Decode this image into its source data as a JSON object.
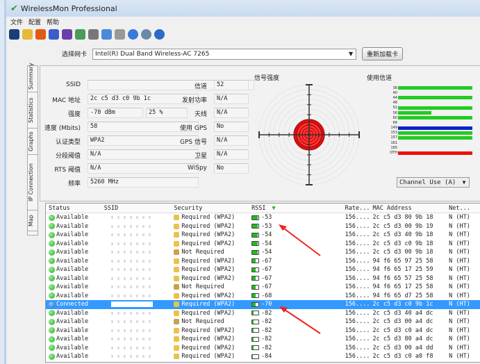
{
  "window": {
    "title": "WirelessMon Professional"
  },
  "menu": [
    "文件",
    "配置",
    "帮助"
  ],
  "toolbar": [
    "save-icon",
    "open-icon",
    "record-icon",
    "adapter-icon",
    "adapter-alt-icon",
    "network-icon",
    "print-icon",
    "settings-icon",
    "clipboard-icon",
    "web-icon",
    "update-icon",
    "help-icon"
  ],
  "nic": {
    "label": "选择网卡",
    "value": "Intel(R) Dual Band Wireless-AC 7265",
    "reload": "重新加载卡"
  },
  "tabs": [
    "Summary",
    "Statistics",
    "Graphs",
    "IP Connection",
    "Map"
  ],
  "summary": {
    "ssid_label": "SSID",
    "ssid": "",
    "mac_label": "MAC 地址",
    "mac": "2c c5 d3 c0 9b 1c",
    "strength_label": "强度",
    "strength_dbm": "-70 dBm",
    "strength_pct": "25 %",
    "speed_label": "速度 (Mbits)",
    "speed": "58",
    "auth_label": "认证类型",
    "auth": "WPA2",
    "frag_label": "分段阈值",
    "frag": "N/A",
    "rts_label": "RTS 阈值",
    "rts": "N/A",
    "freq_label": "频率",
    "freq": "5260 MHz",
    "channel_label": "信道",
    "channel": "52",
    "txpower_label": "发射功率",
    "txpower": "N/A",
    "antenna_label": "天线",
    "antenna": "N/A",
    "gps_label": "使用 GPS",
    "gps": "No",
    "gpssig_label": "GPS 信号",
    "gpssig": "N/A",
    "sat_label": "卫星",
    "sat": "N/A",
    "wispy_label": "WiSpy",
    "wispy": "No"
  },
  "signal": {
    "title": "信号强度",
    "percent": 25
  },
  "channels": {
    "title": "使用信道",
    "dropdown": "Channel Use (A)",
    "items": [
      {
        "ch": "36",
        "use": 1,
        "color": "#22cc22"
      },
      {
        "ch": "40",
        "use": 0,
        "color": "#22cc22"
      },
      {
        "ch": "44",
        "use": 1,
        "color": "#22cc22"
      },
      {
        "ch": "48",
        "use": 0,
        "color": "#22cc22"
      },
      {
        "ch": "52",
        "use": 1,
        "color": "#22cc22"
      },
      {
        "ch": "56",
        "use": 0.45,
        "color": "#22cc22"
      },
      {
        "ch": "60",
        "use": 1,
        "color": "#22cc22"
      },
      {
        "ch": "64",
        "use": 0,
        "color": "#22cc22"
      },
      {
        "ch": "149",
        "use": 1,
        "color": "#1122cc"
      },
      {
        "ch": "153",
        "use": 1,
        "color": "#22cc22"
      },
      {
        "ch": "157",
        "use": 1,
        "color": "#22cc22"
      },
      {
        "ch": "161",
        "use": 0,
        "color": "#22cc22"
      },
      {
        "ch": "165",
        "use": 0,
        "color": "#22cc22"
      },
      {
        "ch": "OTH",
        "use": 1,
        "color": "#ee1111"
      }
    ]
  },
  "list": {
    "headers": [
      "Status",
      "SSID",
      "Security",
      "RSSI",
      "Rate...",
      "MAC Address",
      "Net..."
    ],
    "rows": [
      {
        "status": "Available",
        "security": "Required (WPA2)",
        "rssi": "-53",
        "rate": "156....",
        "mac": "2c c5 d3 80 9b 18",
        "net": "N (HT)"
      },
      {
        "status": "Available",
        "security": "Required (WPA2)",
        "rssi": "-53",
        "rate": "156....",
        "mac": "2c c5 d3 00 9b 19",
        "net": "N (HT)"
      },
      {
        "status": "Available",
        "security": "Required (WPA2)",
        "rssi": "-54",
        "rate": "156....",
        "mac": "2c c5 d3 40 9b 18",
        "net": "N (HT)"
      },
      {
        "status": "Available",
        "security": "Required (WPA2)",
        "rssi": "-54",
        "rate": "156....",
        "mac": "2c c5 d3 c0 9b 18",
        "net": "N (HT)"
      },
      {
        "status": "Available",
        "security": "Not Required",
        "rssi": "-54",
        "rate": "156....",
        "mac": "2c c5 d3 00 9b 18",
        "net": "N (HT)"
      },
      {
        "status": "Available",
        "security": "Required (WPA2)",
        "rssi": "-67",
        "rate": "156....",
        "mac": "94 f6 65 97 25 58",
        "net": "N (HT)"
      },
      {
        "status": "Available",
        "security": "Required (WPA2)",
        "rssi": "-67",
        "rate": "156....",
        "mac": "94 f6 65 17 25 59",
        "net": "N (HT)"
      },
      {
        "status": "Available",
        "security": "Required (WPA2)",
        "rssi": "-67",
        "rate": "156....",
        "mac": "94 f6 65 57 25 58",
        "net": "N (HT)"
      },
      {
        "status": "Available",
        "security": "Not Required",
        "rssi": "-67",
        "rate": "156....",
        "mac": "94 f6 65 17 25 58",
        "net": "N (HT)"
      },
      {
        "status": "Available",
        "security": "Required (WPA2)",
        "rssi": "-68",
        "rate": "156....",
        "mac": "94 f6 65 d7 25 58",
        "net": "N (HT)"
      },
      {
        "status": "Connected",
        "security": "Required (WPA2)",
        "rssi": "-70",
        "rate": "156....",
        "mac": "2c c5 d3 c0 9b 1c",
        "net": "N (HT)",
        "selected": true
      },
      {
        "status": "Available",
        "security": "Required (WPA2)",
        "rssi": "-82",
        "rate": "156....",
        "mac": "2c c5 d3 40 a4 dc",
        "net": "N (HT)"
      },
      {
        "status": "Available",
        "security": "Not Required",
        "rssi": "-82",
        "rate": "156....",
        "mac": "2c c5 d3 00 a4 dc",
        "net": "N (HT)"
      },
      {
        "status": "Available",
        "security": "Required (WPA2)",
        "rssi": "-82",
        "rate": "156....",
        "mac": "2c c5 d3 c0 a4 dc",
        "net": "N (HT)"
      },
      {
        "status": "Available",
        "security": "Required (WPA2)",
        "rssi": "-82",
        "rate": "156....",
        "mac": "2c c5 d3 80 a4 dc",
        "net": "N (HT)"
      },
      {
        "status": "Available",
        "security": "Required (WPA2)",
        "rssi": "-82",
        "rate": "156....",
        "mac": "2c c5 d3 00 a4 dd",
        "net": "N (HT)"
      },
      {
        "status": "Available",
        "security": "Required (WPA2)",
        "rssi": "-84",
        "rate": "156....",
        "mac": "2c c5 d3 c0 a0 f8",
        "net": "N (HT)"
      }
    ]
  }
}
